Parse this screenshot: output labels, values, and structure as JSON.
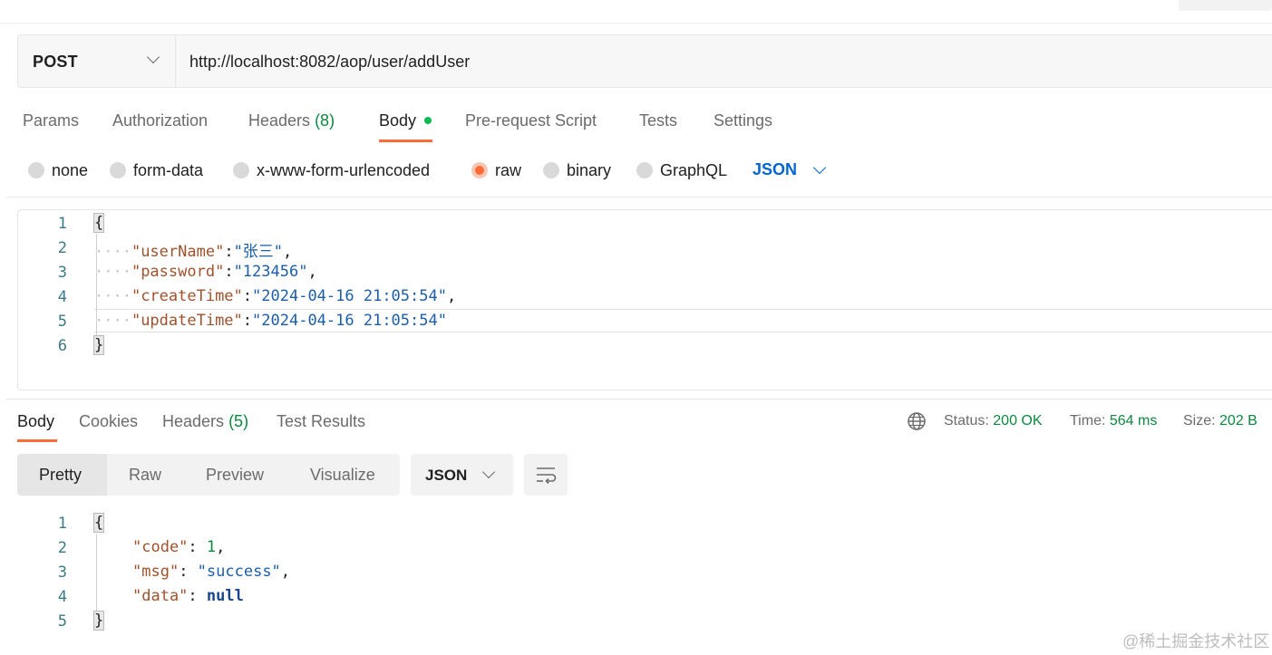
{
  "request": {
    "method": "POST",
    "url": "http://localhost:8082/aop/user/addUser"
  },
  "request_tabs": {
    "params": "Params",
    "authorization": "Authorization",
    "headers": "Headers",
    "headers_count": "(8)",
    "body": "Body",
    "prerequest": "Pre-request Script",
    "tests": "Tests",
    "settings": "Settings",
    "active": "Body"
  },
  "body_types": {
    "options": [
      "none",
      "form-data",
      "x-www-form-urlencoded",
      "raw",
      "binary",
      "GraphQL"
    ],
    "selected": "raw",
    "format": "JSON"
  },
  "request_body": {
    "line_numbers": [
      "1",
      "2",
      "3",
      "4",
      "5",
      "6"
    ],
    "open": "{",
    "close": "}",
    "fields": [
      {
        "key": "\"userName\"",
        "value": "\"张三\"",
        "comma": ","
      },
      {
        "key": "\"password\"",
        "value": "\"123456\"",
        "comma": ","
      },
      {
        "key": "\"createTime\"",
        "value": "\"2024-04-16 21:05:54\"",
        "comma": ","
      },
      {
        "key": "\"updateTime\"",
        "value": "\"2024-04-16 21:05:54\"",
        "comma": ""
      }
    ]
  },
  "response_tabs": {
    "body": "Body",
    "cookies": "Cookies",
    "headers": "Headers",
    "headers_count": "(5)",
    "test_results": "Test Results",
    "active": "Body"
  },
  "response_meta": {
    "status_label": "Status:",
    "status": "200 OK",
    "time_label": "Time:",
    "time": "564 ms",
    "size_label": "Size:",
    "size": "202 B"
  },
  "response_view": {
    "modes": [
      "Pretty",
      "Raw",
      "Preview",
      "Visualize"
    ],
    "active": "Pretty",
    "format": "JSON"
  },
  "response_body": {
    "line_numbers": [
      "1",
      "2",
      "3",
      "4",
      "5"
    ],
    "open": "{",
    "close": "}",
    "code_key": "\"code\"",
    "code_value": "1",
    "msg_key": "\"msg\"",
    "msg_value": "\"success\"",
    "data_key": "\"data\"",
    "data_value": "null"
  },
  "watermark": "@稀土掘金技术社区",
  "colors": {
    "accent": "#ff6c37",
    "status_green": "#0b8a3e",
    "link_blue": "#0265d2"
  }
}
